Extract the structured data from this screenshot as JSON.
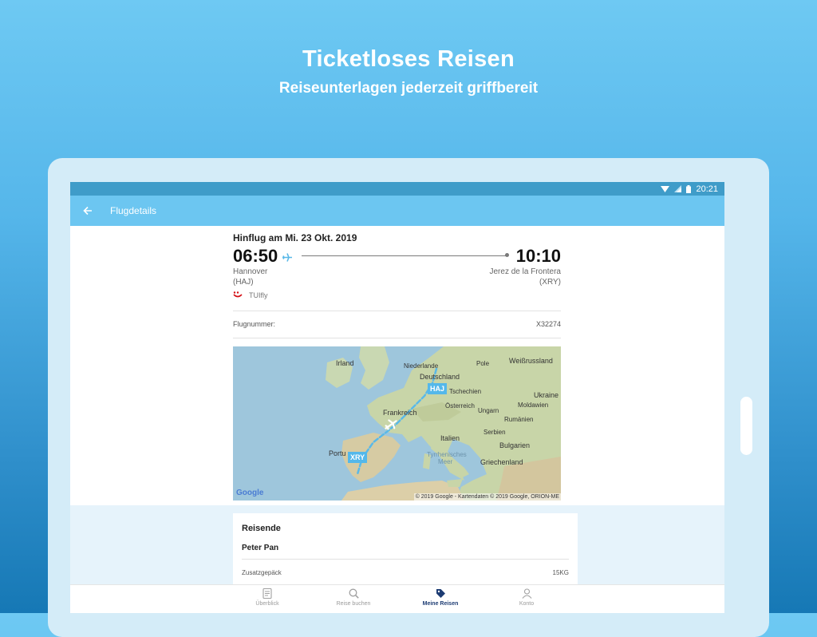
{
  "promo": {
    "title": "Ticketloses Reisen",
    "subtitle": "Reiseunterlagen jederzeit griffbereit"
  },
  "status_bar": {
    "time": "20:21"
  },
  "app_bar": {
    "title": "Flugdetails",
    "back_icon": "arrow-left-icon"
  },
  "flight": {
    "heading": "Hinflug am Mi. 23 Okt. 2019",
    "departure": {
      "time": "06:50",
      "city": "Hannover",
      "code": "(HAJ)"
    },
    "arrival": {
      "time": "10:10",
      "city": "Jerez de la Frontera",
      "code": "(XRY)"
    },
    "airline": "TUIfly",
    "flight_number_label": "Flugnummer:",
    "flight_number": "X32274"
  },
  "map": {
    "labels": {
      "irland": "Irland",
      "niederlande": "Niederlande",
      "deutschland": "Deutschland",
      "pole": "Pole",
      "weissrussland": "Weißrussland",
      "tschechien": "Tschechien",
      "ukraine": "Ukraine",
      "frankreich": "Frankreich",
      "oesterreich": "Österreich",
      "ungarn": "Ungarn",
      "moldawien": "Moldawien",
      "rumaenien": "Rumänien",
      "serbien": "Serbien",
      "italien": "Italien",
      "bulgarien": "Bulgarien",
      "tyrrhenisches": "Tyrrhenisches",
      "meer": "Meer",
      "griechenland": "Griechenland",
      "portu": "Portu"
    },
    "pins": {
      "origin": "HAJ",
      "destination": "XRY"
    },
    "google": "Google",
    "attribution": "© 2019 Google - Kartendaten © 2019 Google, ORION-ME"
  },
  "passengers": {
    "title": "Reisende",
    "name": "Peter Pan",
    "baggage_label": "Zusatzgepäck",
    "baggage_value": "15KG"
  },
  "nav": {
    "items": [
      {
        "label": "Überblick",
        "icon": "document-icon"
      },
      {
        "label": "Reise buchen",
        "icon": "search-icon"
      },
      {
        "label": "Meine Reisen",
        "icon": "tag-icon"
      },
      {
        "label": "Konto",
        "icon": "person-icon"
      }
    ],
    "active_index": 2
  },
  "colors": {
    "accent": "#6cc6f1",
    "status_bar": "#3f9cc9",
    "nav_active": "#1d3c73",
    "map_pin": "#54b8ea",
    "tui_red": "#d40e14"
  }
}
